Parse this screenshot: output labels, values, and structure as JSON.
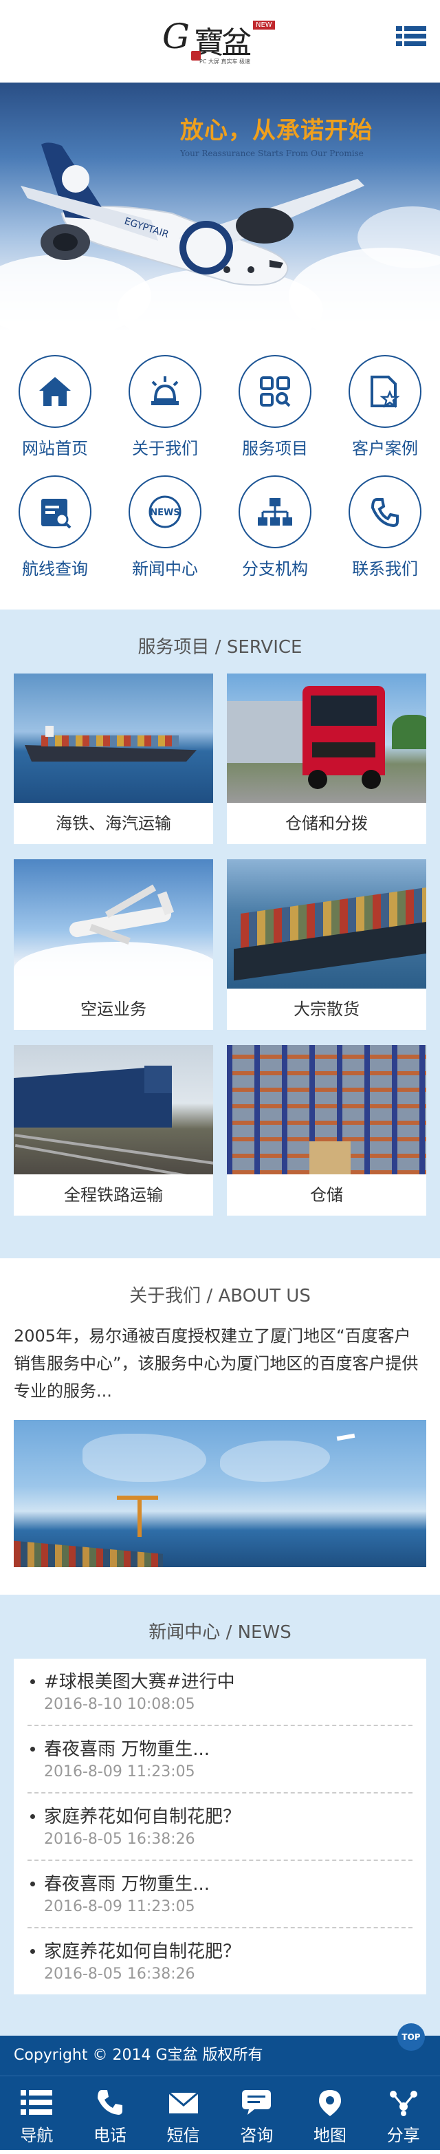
{
  "header": {
    "logo_g": "G",
    "logo_cn": "寶盆",
    "logo_badge": "NEW",
    "logo_sub": "PC 大屏  真实车  极速"
  },
  "banner": {
    "title": "放心，从承诺开始",
    "subtitle": "Your Reassurance Starts From Our Promise",
    "plane_text": "EGYPTAIR"
  },
  "nav": [
    {
      "label": "网站首页",
      "icon": "home-icon"
    },
    {
      "label": "关于我们",
      "icon": "lamp-icon"
    },
    {
      "label": "服务项目",
      "icon": "grid-search-icon"
    },
    {
      "label": "客户案例",
      "icon": "document-star-icon"
    },
    {
      "label": "航线查询",
      "icon": "calendar-search-icon"
    },
    {
      "label": "新闻中心",
      "icon": "news-icon"
    },
    {
      "label": "分支机构",
      "icon": "org-chart-icon"
    },
    {
      "label": "联系我们",
      "icon": "phone-icon"
    }
  ],
  "services": {
    "title_cn": "服务项目",
    "title_sep": " / ",
    "title_en": "SERVICE",
    "items": [
      {
        "label": "海铁、海汽运输"
      },
      {
        "label": "仓储和分拨"
      },
      {
        "label": "空运业务"
      },
      {
        "label": "大宗散货"
      },
      {
        "label": "全程铁路运输"
      },
      {
        "label": "仓储"
      }
    ]
  },
  "about": {
    "title_cn": "关于我们",
    "title_sep": " / ",
    "title_en": "ABOUT US",
    "text": "2005年，易尔通被百度授权建立了厦门地区“百度客户销售服务中心”，该服务中心为厦门地区的百度客户提供专业的服务..."
  },
  "news": {
    "title_cn": "新闻中心",
    "title_sep": " / ",
    "title_en": "NEWS",
    "items": [
      {
        "title": "#球根美图大赛#进行中",
        "date": "2016-8-10  10:08:05"
      },
      {
        "title": "春夜喜雨 万物重生...",
        "date": "2016-8-09  11:23:05"
      },
      {
        "title": "家庭养花如何自制花肥？",
        "date": "2016-8-05  16:38:26"
      },
      {
        "title": "春夜喜雨 万物重生...",
        "date": "2016-8-09  11:23:05"
      },
      {
        "title": "家庭养花如何自制花肥？",
        "date": "2016-8-05  16:38:26"
      }
    ]
  },
  "footer": {
    "copyright": "Copyright © 2014 G宝盆 版权所有",
    "top_label": "TOP"
  },
  "toolbar": [
    {
      "label": "导航",
      "icon": "list-icon"
    },
    {
      "label": "电话",
      "icon": "phone-icon"
    },
    {
      "label": "短信",
      "icon": "envelope-icon"
    },
    {
      "label": "咨询",
      "icon": "chat-icon"
    },
    {
      "label": "地图",
      "icon": "map-pin-icon"
    },
    {
      "label": "分享",
      "icon": "share-icon"
    }
  ],
  "colors": {
    "brand_blue": "#1c5494",
    "footer_blue": "#0d4f8f",
    "section_bg": "#d7e9f7",
    "accent_orange": "#f0a01c"
  }
}
